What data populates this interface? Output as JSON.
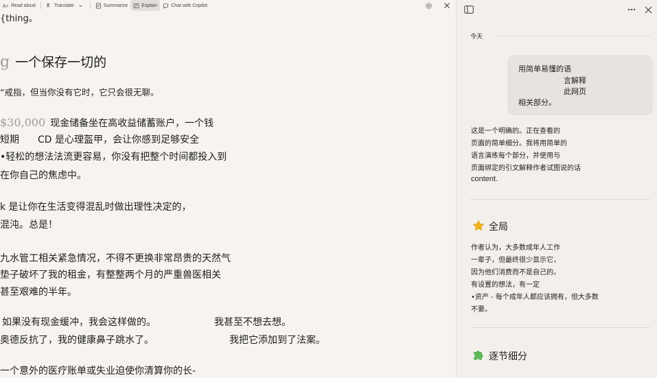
{
  "toolbar": {
    "read_aloud": "Read aloud",
    "translate": "Translate",
    "summarize": "Summarize",
    "explain": "Explain",
    "chat": "Chat with Copilot"
  },
  "reader": {
    "l0": "{thing。",
    "heading_prefix": "g",
    "heading": "一个保存一切的",
    "l2": "“戒指，但当你没有它时，它只会很无聊。",
    "amount": "$30,000",
    "l3b": "现金储备坐在高收益储蓄账户，一个钱",
    "l4a": "短期",
    "l4b": "CD 是心理盔甲，会让你感到足够安全",
    "l5": "•轻松的想法法流更容易，你没有把整个时间都投入到",
    "l6": "在你自己的焦虑中。",
    "l7": "k 是让你在生活变得混乱时做出理性决定的，",
    "l8": "混沌。总是！",
    "l9": "九水管工相关紧急情况，不得不更换非常昂贵的天然气",
    "l10": "垫子破坏了我的租金，有整整两个月的严重兽医相关",
    "l11": "甚至艰难的半年。",
    "l12a": "如果没有现金缓冲，我会这样做的。",
    "l12b": "我甚至不想去想。",
    "l13a": "奥德反抗了，我的健康鼻子跳水了。",
    "l13b": "我把它添加到了法案。",
    "l14": "一个意外的医疗账单或失业迫使你清算你的长-"
  },
  "panel": {
    "today": "今天",
    "user_msg": [
      "用简单易懂的语",
      "言解释",
      "此网页",
      "相关部分。"
    ],
    "answer": [
      "这是一个明确的。正在查看的",
      "页面的简单细分。我将用简单的",
      "语言演练每个部分，并使用与",
      "页面绑定的引文解释作者试图说的话",
      "content."
    ],
    "sections": [
      {
        "title": "全局",
        "body": [
          "作者认为，大多数成年人工作",
          "一辈子，但最终很少显示它，",
          "因为他们消费而不是自己的。",
          "有设置的想法，有一定",
          "•资产 - 每个成年人都应该拥有，但大多数",
          "不要。"
        ]
      },
      {
        "title": "逐节细分",
        "body": []
      }
    ]
  },
  "colors": {
    "star": "#f2b21b",
    "puzzle": "#5fb85a",
    "accent_bg": "#e7e3df"
  }
}
